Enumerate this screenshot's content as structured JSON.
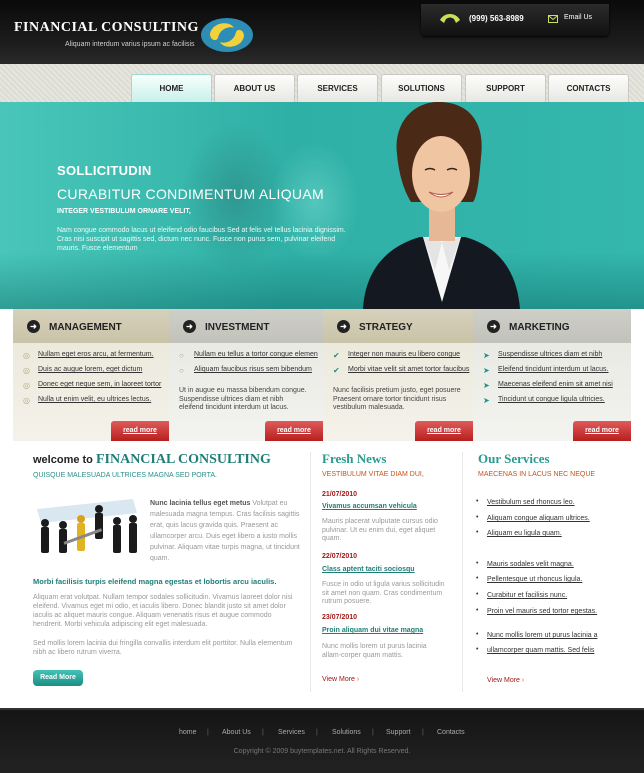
{
  "header": {
    "logo_title": "FINANCIAL CONSULTING",
    "logo_subtitle": "Aliquam interdum varius ipsum ac facilisis",
    "phone": "(999) 563-8989",
    "email_label": "Email Us"
  },
  "nav": {
    "tabs": [
      "HOME",
      "ABOUT US",
      "SERVICES",
      "SOLUTIONS",
      "SUPPORT",
      "CONTACTS"
    ],
    "active": "HOME"
  },
  "hero": {
    "title": "SOLLICITUDIN",
    "subtitle": "CURABITUR CONDIMENTUM ALIQUAM",
    "tagline": "INTEGER VESTIBULUM ORNARE VELIT,",
    "text": "Nam congue commodo lacus ut eleifend odio faucibus Sed at felis vel tellus lacinia dignissim. Cras nisi suscipit ut sagittis sed, dictum nec nunc. Fusce non purus sem, pulvinar eleifend mauris. Fusce elementum"
  },
  "features": [
    {
      "title": "MANAGEMENT",
      "items": [
        "Nullam eget eros arcu, at fermentum.",
        "Duis ac augue lorem, eget dictum",
        "Donec eget neque sem, in laoreet tortor",
        "Nulla ut enim velit, eu ultrices lectus."
      ],
      "bullet": "circle",
      "desc": "",
      "readmore": "read more"
    },
    {
      "title": "INVESTMENT",
      "items": [
        "Nullam eu tellus a tortor congue elemen",
        "Aliquam faucibus risus sem bibendum"
      ],
      "bullet": "radio",
      "desc": "Ut in augue eu massa bibendum congue. Suspendisse ultrices diam et nibh eleifend tincidunt interdum ut lacus.",
      "readmore": "read more"
    },
    {
      "title": "STRATEGY",
      "items": [
        "Integer non mauris eu libero congue",
        "Morbi vitae velit sit amet tortor faucibus"
      ],
      "bullet": "check",
      "desc": "Nunc facilisis pretium justo, eget posuere Praesent ornare tortor tincidunt risus vestibulum malesuada.",
      "readmore": "read more"
    },
    {
      "title": "MARKETING",
      "items": [
        "Suspendisse ultrices diam et nibh",
        "Eleifend tincidunt interdum ut lacus.",
        "Maecenas eleifend enim sit amet nisi",
        "Tincidunt ut congue ligula ultricies."
      ],
      "bullet": "arrow",
      "desc": "",
      "readmore": "read more"
    }
  ],
  "welcome": {
    "prefix": "welcome to",
    "title": "FINANCIAL CONSULTING",
    "subtitle": "QUISQUE MALESUADA ULTRICES MAGNA SED PORTA.",
    "lead_bold": "Nunc lacinia tellus eget metus",
    "lead_text": "Volutpat eu malesuada magna tempus. Cras facilisis sagittis erat, quis lacus gravida quis. Praesent ac ullamcorper arcu. Duis eget libero a iusto mollis pulvinar. Aliquam vitae turpis magna, ut tincidunt quam.",
    "mid_title": "Morbi facilisis turpis eleifend magna egestas et lobortis arcu iaculis.",
    "para1": "Aliquam erat volutpat. Nullam tempor sodales sollicitudin. Vivamus laoreet dolor nisi eleifend. Vivamus eget mi odio, et iaculis libero. Donec blandit justo sit amet dolor iaculis ac aliquet mauris congue. Aliquam venenatis risus et augue commodo hendrerit. Morbi vehicula adipiscing elit eget malesuada.",
    "para2": "Sed mollis lorem lacinia dui fringilla convallis interdum elit porttitor. Nulla elementum nibh ac libero rutrum viverra.",
    "readmore": "Read More"
  },
  "news": {
    "title": "Fresh News",
    "subtitle": "VESTIBULUM VITAE DIAM DUI,",
    "items": [
      {
        "date": "21/07/2010",
        "link": "Vivamus accumsan vehicula",
        "text": "Mauris placerat vulputate cursus odio pulvinar. Ut eu enim dui, eget aliquet quam."
      },
      {
        "date": "22/07/2010",
        "link": "Class aptent taciti sociosqu",
        "text": "Fusce in odio ut ligula varius sollicitudin sit amet non quam. Cras condimentum rutrum posuere."
      },
      {
        "date": "23/07/2010",
        "link": "Proin aliquam dui vitae magna",
        "text": "Nunc mollis lorem ut purus lacinia allam-corper quam mattis."
      }
    ],
    "viewmore": "View More"
  },
  "services": {
    "title": "Our Services",
    "subtitle": "MAECENAS IN LACUS NEC NEQUE",
    "items": [
      "Vestibulum sed rhoncus leo.",
      "Aliquam congue aliquam ultrices.",
      "Aliquam eu ligula quam.",
      "Mauris sodales velit magna.",
      "Pellentesque ut rhoncus ligula.",
      "Curabitur et facilisis nunc.",
      "Proin vel mauris sed tortor egestas.",
      "Nunc mollis lorem ut purus lacinia a",
      "ullamcorper quam mattis. Sed felis"
    ],
    "viewmore": "View More"
  },
  "footer": {
    "links": [
      "home",
      "About Us",
      "Services",
      "Solutions",
      "Support",
      "Contacts"
    ],
    "copyright": "Copyright © 2009 buytemplates.net. All Rights Reserved."
  },
  "colors": {
    "teal": "#2fb0a6",
    "red": "#c0281f",
    "dark": "#141414"
  }
}
